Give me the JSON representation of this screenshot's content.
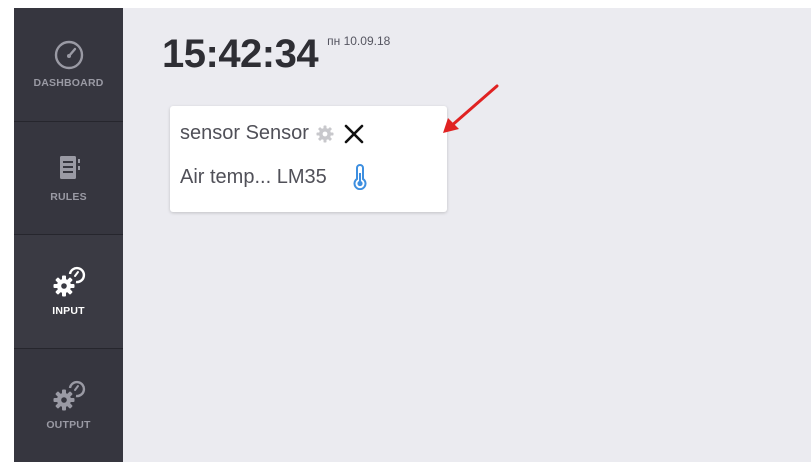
{
  "sidebar": {
    "items": [
      {
        "label": "DASHBOARD",
        "icon": "speedometer-icon",
        "active": false
      },
      {
        "label": "RULES",
        "icon": "document-icon",
        "active": false
      },
      {
        "label": "INPUT",
        "icon": "gears-icon",
        "active": true
      },
      {
        "label": "OUTPUT",
        "icon": "gears-icon",
        "active": false
      }
    ],
    "active_color": "#52c45a"
  },
  "header": {
    "time": "15:42:34",
    "date": "пн 10.09.18"
  },
  "card": {
    "title": "sensor Sensor",
    "subtitle": "Air temp... LM35",
    "settings_icon": "gear-icon",
    "close_icon": "close-icon",
    "type_icon": "thermometer-icon"
  },
  "annotation": {
    "arrow_color": "#e02222",
    "points_to": "close-icon"
  }
}
